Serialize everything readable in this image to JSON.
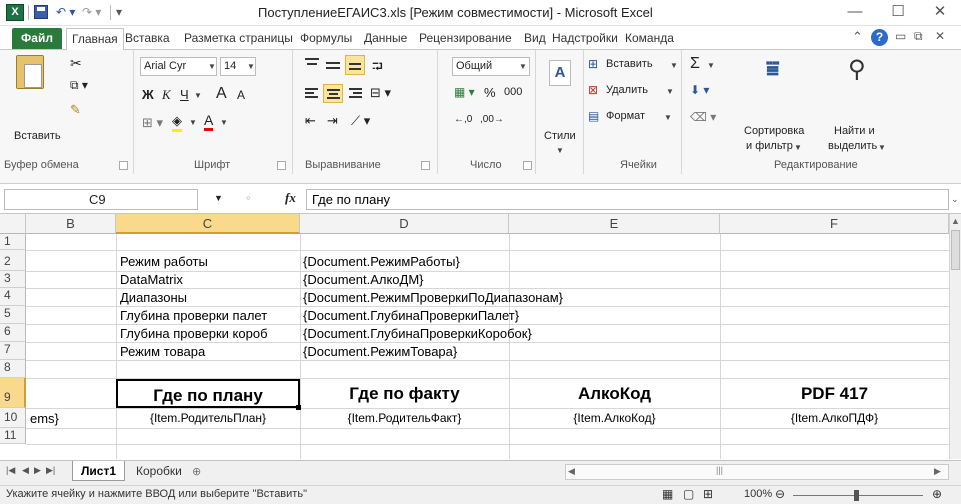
{
  "titlebar": {
    "app_icon": "X",
    "title": "ПоступлениеЕГАИС3.xls  [Режим совместимости]  -  Microsoft Excel",
    "minimize": "—",
    "maximize": "☐",
    "close": "✕"
  },
  "menu": {
    "file": "Файл",
    "tabs": [
      "Главная",
      "Вставка",
      "Разметка страницы",
      "Формулы",
      "Данные",
      "Рецензирование",
      "Вид",
      "Надстройки",
      "Команда"
    ],
    "help": "?"
  },
  "ribbon": {
    "clipboard": {
      "paste": "Вставить",
      "label": "Буфер обмена"
    },
    "font": {
      "name": "Arial Cyr",
      "size": "14",
      "bold": "Ж",
      "italic": "К",
      "underline": "Ч",
      "grow": "A",
      "shrink": "A",
      "label": "Шрифт"
    },
    "align": {
      "label": "Выравнивание"
    },
    "number": {
      "format": "Общий",
      "percent": "%",
      "thousands": "000",
      "label": "Число"
    },
    "styles": {
      "label": "Стили"
    },
    "cells": {
      "insert": "Вставить",
      "delete": "Удалить",
      "format": "Формат",
      "label": "Ячейки"
    },
    "editing": {
      "sigma": "Σ",
      "sort": "Сортировка",
      "sort2": "и фильтр",
      "find": "Найти и",
      "find2": "выделить",
      "label": "Редактирование"
    }
  },
  "formula_bar": {
    "name_box": "C9",
    "fx": "fx",
    "content": "Где по плану"
  },
  "columns": [
    "B",
    "C",
    "D",
    "E",
    "F"
  ],
  "rows": [
    "1",
    "2",
    "3",
    "4",
    "5",
    "6",
    "7",
    "8",
    "9",
    "10",
    "11"
  ],
  "cells": {
    "c2": "Режим работы",
    "d2": "{Document.РежимРаботы}",
    "c3": "DataMatrix",
    "d3": "{Document.АлкоДМ}",
    "c4": "Диапазоны",
    "d4": "{Document.РежимПроверкиПоДиапазонам}",
    "c5": "Глубина проверки палет",
    "d5": "{Document.ГлубинаПроверкиПалет}",
    "c6": "Глубина проверки короб",
    "d6": "{Document.ГлубинаПроверкиКоробок}",
    "c7": "Режим товара",
    "d7": "{Document.РежимТовара}",
    "c9": "Где по плану",
    "d9": "Где по факту",
    "e9": "АлкоКод",
    "f9": "PDF 417",
    "b10": "ems}",
    "c10": "{Item.РодительПлан}",
    "d10": "{Item.РодительФакт}",
    "e10": "{Item.АлкоКод}",
    "f10": "{Item.АлкоПДФ}"
  },
  "sheets": {
    "active": "Лист1",
    "other": "Коробки"
  },
  "status": {
    "message": "Укажите ячейку и нажмите ВВОД или выберите \"Вставить\"",
    "zoom": "100%"
  }
}
